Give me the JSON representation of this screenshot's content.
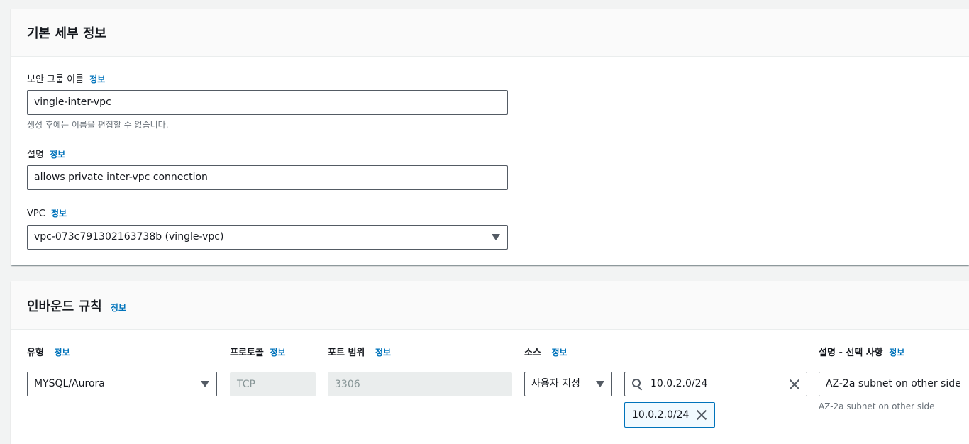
{
  "info_label": "정보",
  "basic": {
    "title": "기본 세부 정보",
    "name_label": "보안 그룹 이름",
    "name_value": "vingle-inter-vpc",
    "name_hint": "생성 후에는 이름을 편집할 수 없습니다.",
    "desc_label": "설명",
    "desc_value": "allows private inter-vpc connection",
    "vpc_label": "VPC",
    "vpc_value": "vpc-073c791302163738b (vingle-vpc)"
  },
  "inbound": {
    "title": "인바운드 규칙",
    "headers": {
      "type": "유형",
      "protocol": "프로토콜",
      "port_range": "포트 범위",
      "source": "소스",
      "description": "설명 - 선택 사항"
    },
    "row": {
      "type": "MYSQL/Aurora",
      "protocol": "TCP",
      "port_range": "3306",
      "source_type": "사용자 지정",
      "source_search": "10.0.2.0/24",
      "source_token": "10.0.2.0/24",
      "description": "AZ-2a subnet on other side",
      "description_hint": "AZ-2a subnet on other side"
    }
  },
  "colors": {
    "link": "#0073bb",
    "border": "#545b64",
    "background": "#f2f3f3"
  },
  "icons": [
    "caret-down-icon",
    "search-icon",
    "close-icon"
  ]
}
